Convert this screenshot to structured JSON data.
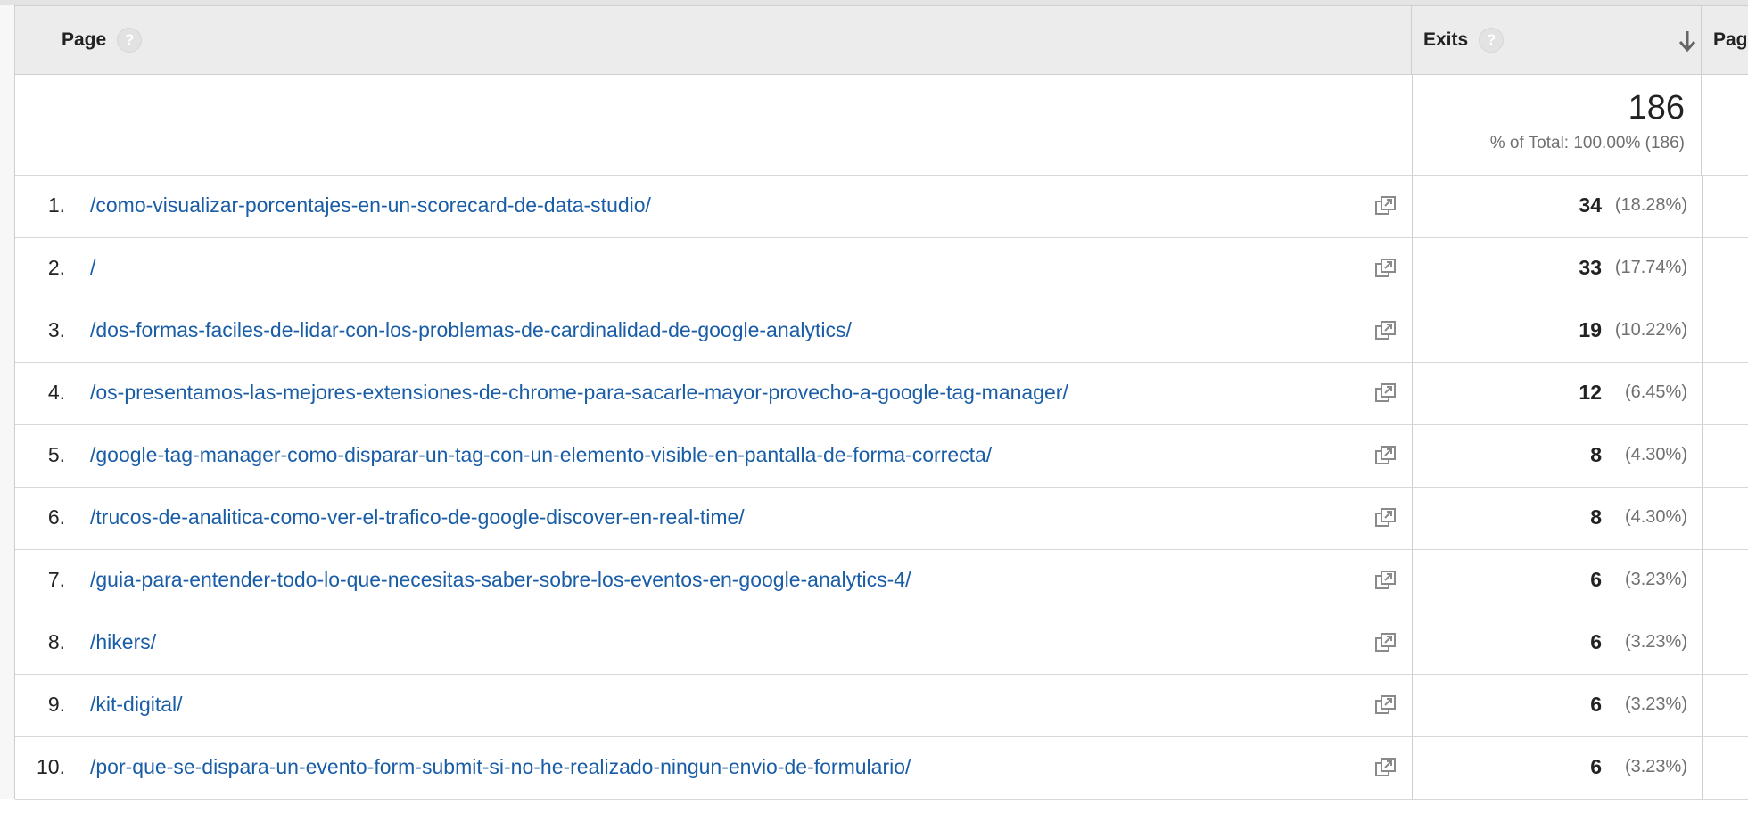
{
  "header": {
    "page_label": "Page",
    "exits_label": "Exits",
    "next_label": "Pag",
    "help_glyph": "?"
  },
  "totals": {
    "value": "186",
    "subtitle": "% of Total: 100.00% (186)"
  },
  "rows": [
    {
      "index": "1.",
      "page": "/como-visualizar-porcentajes-en-un-scorecard-de-data-studio/",
      "exits": "34",
      "pct": "(18.28%)"
    },
    {
      "index": "2.",
      "page": "/",
      "exits": "33",
      "pct": "(17.74%)"
    },
    {
      "index": "3.",
      "page": "/dos-formas-faciles-de-lidar-con-los-problemas-de-cardinalidad-de-google-analytics/",
      "exits": "19",
      "pct": "(10.22%)"
    },
    {
      "index": "4.",
      "page": "/os-presentamos-las-mejores-extensiones-de-chrome-para-sacarle-mayor-provecho-a-google-tag-manager/",
      "exits": "12",
      "pct": "(6.45%)"
    },
    {
      "index": "5.",
      "page": "/google-tag-manager-como-disparar-un-tag-con-un-elemento-visible-en-pantalla-de-forma-correcta/",
      "exits": "8",
      "pct": "(4.30%)"
    },
    {
      "index": "6.",
      "page": "/trucos-de-analitica-como-ver-el-trafico-de-google-discover-en-real-time/",
      "exits": "8",
      "pct": "(4.30%)"
    },
    {
      "index": "7.",
      "page": "/guia-para-entender-todo-lo-que-necesitas-saber-sobre-los-eventos-en-google-analytics-4/",
      "exits": "6",
      "pct": "(3.23%)"
    },
    {
      "index": "8.",
      "page": "/hikers/",
      "exits": "6",
      "pct": "(3.23%)"
    },
    {
      "index": "9.",
      "page": "/kit-digital/",
      "exits": "6",
      "pct": "(3.23%)"
    },
    {
      "index": "10.",
      "page": "/por-que-se-dispara-un-evento-form-submit-si-no-he-realizado-ningun-envio-de-formulario/",
      "exits": "6",
      "pct": "(3.23%)"
    }
  ],
  "icons": {
    "help": "help-circle-icon",
    "sort": "arrow-down-icon",
    "open_page": "external-window-icon"
  },
  "colors": {
    "link": "#1a5da7",
    "header_bg": "#ececec"
  }
}
